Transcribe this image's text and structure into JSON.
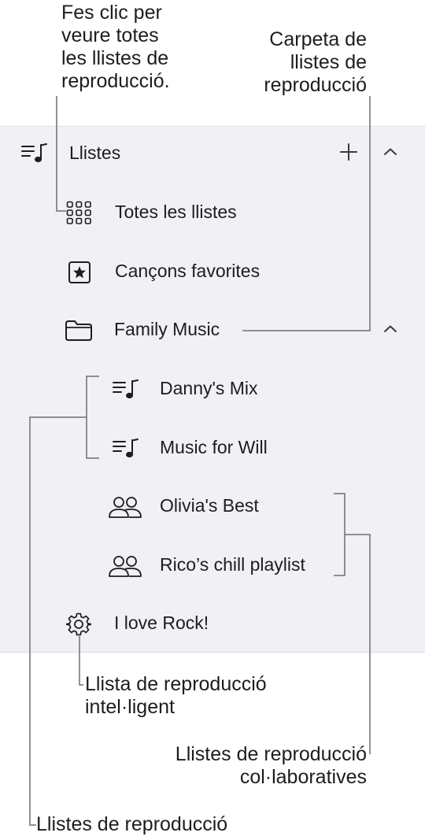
{
  "callouts": {
    "all_playlists": "Fes clic per\nveure totes\nles llistes de\nreproducció.",
    "folder": "Carpeta de\nllistes de\nreproducció",
    "smart": "Llista de reproducció\nintel·ligent",
    "collaborative": "Llistes de reproducció\ncol·laboratives",
    "playlists": "Llistes de reproducció"
  },
  "sidebar": {
    "section_title": "Llistes",
    "items": {
      "all": "Totes les llistes",
      "favorites": "Cançons favorites",
      "folder": "Family Music",
      "danny": "Danny's Mix",
      "will": "Music for Will",
      "olivia": "Olivia's Best",
      "rico": "Rico’s chill playlist",
      "rock": "I love Rock!"
    }
  },
  "icons": {
    "section": "playlist-icon",
    "add": "plus-icon",
    "collapse": "chevron-up-icon",
    "all": "grid-icon",
    "favorites": "star-square-icon",
    "folder": "folder-icon",
    "playlist": "playlist-icon",
    "collaborative": "people-icon",
    "smart": "gear-icon"
  },
  "colors": {
    "sidebar_bg": "#f1f1f5",
    "text": "#1d1d1f",
    "callout_line": "#6e6e73"
  }
}
